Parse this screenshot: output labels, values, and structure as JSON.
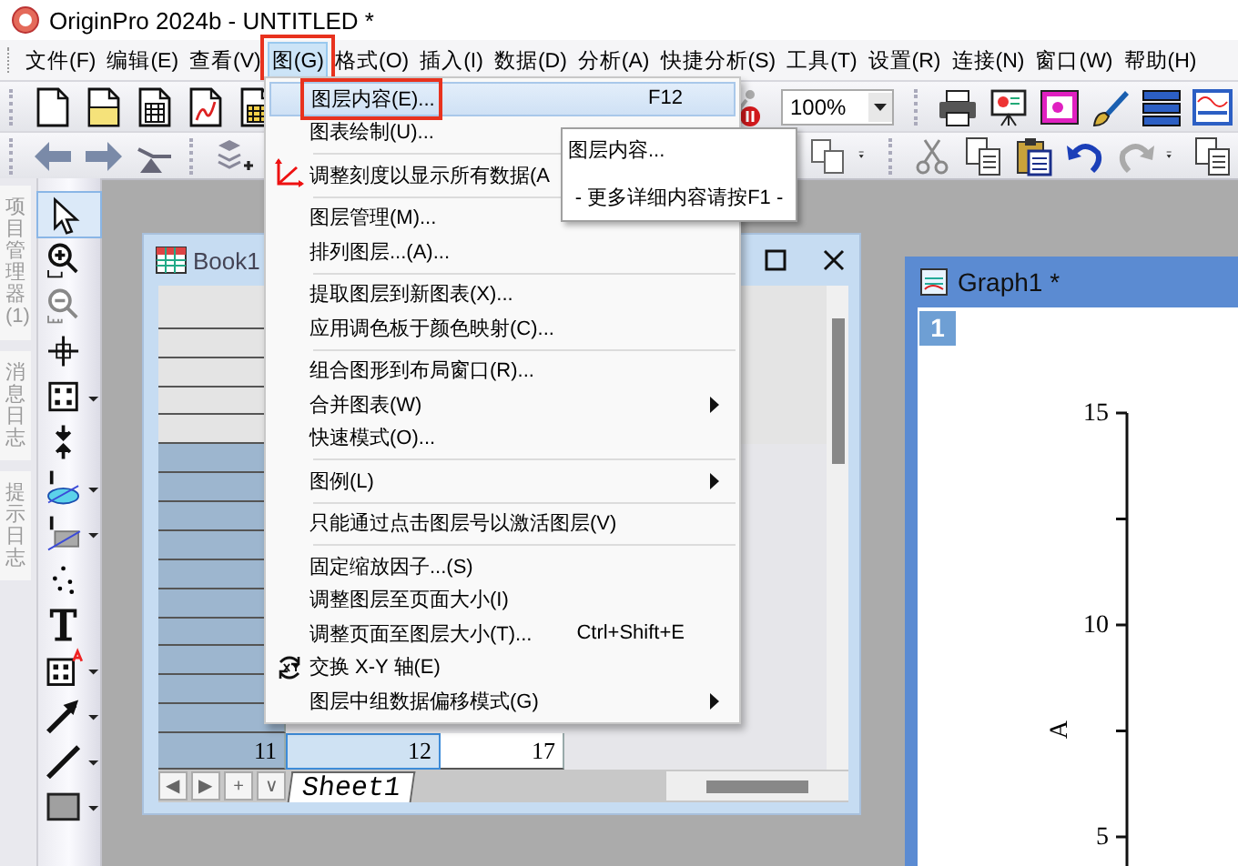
{
  "window": {
    "title": "OriginPro 2024b - UNTITLED *"
  },
  "menu_bar": [
    {
      "label": "文件(F)",
      "selected": false,
      "annotated": false
    },
    {
      "label": "编辑(E)",
      "selected": false,
      "annotated": false
    },
    {
      "label": "查看(V)",
      "selected": false,
      "annotated": false
    },
    {
      "label": "图(G)",
      "selected": true,
      "annotated": true
    },
    {
      "label": "格式(O)",
      "selected": false,
      "annotated": false
    },
    {
      "label": "插入(I)",
      "selected": false,
      "annotated": false
    },
    {
      "label": "数据(D)",
      "selected": false,
      "annotated": false
    },
    {
      "label": "分析(A)",
      "selected": false,
      "annotated": false
    },
    {
      "label": "快捷分析(S)",
      "selected": false,
      "annotated": false
    },
    {
      "label": "工具(T)",
      "selected": false,
      "annotated": false
    },
    {
      "label": "设置(R)",
      "selected": false,
      "annotated": false
    },
    {
      "label": "连接(N)",
      "selected": false,
      "annotated": false
    },
    {
      "label": "窗口(W)",
      "selected": false,
      "annotated": false
    },
    {
      "label": "帮助(H)",
      "selected": false,
      "annotated": false
    }
  ],
  "toolbar": {
    "zoom_combo": {
      "value": "100%"
    }
  },
  "side_panels": [
    {
      "label": "项目管理器 (1)"
    },
    {
      "label": "消息日志"
    },
    {
      "label": "提示日志"
    }
  ],
  "book_window": {
    "title": "Book1",
    "last_row": [
      {
        "text": "11",
        "selected": false
      },
      {
        "text": "12",
        "selected": true
      },
      {
        "text": "17",
        "selected": false
      }
    ],
    "sheet_nav": [
      "◀",
      "▶",
      "+",
      "∨"
    ],
    "sheet_tabs": [
      {
        "label": "Sheet1",
        "selected": true
      }
    ]
  },
  "graph_window": {
    "title": "Graph1 *",
    "layer_badge": "1",
    "y_tick_labels": [
      "15",
      "10",
      "5"
    ],
    "y_axis_title": "A"
  },
  "dropdown_menu": {
    "items": [
      {
        "kind": "item",
        "label": "图层内容(E)...",
        "shortcut": "F12",
        "selected": true,
        "annotated": true,
        "submenu": false
      },
      {
        "kind": "item",
        "label": "图表绘制(U)...",
        "selected": false,
        "annotated": false,
        "submenu": false
      },
      {
        "kind": "separator"
      },
      {
        "kind": "item",
        "label": "调整刻度以显示所有数据(A",
        "selected": false,
        "annotated": false,
        "submenu": false
      },
      {
        "kind": "separator"
      },
      {
        "kind": "item",
        "label": "图层管理(M)...",
        "selected": false,
        "annotated": false,
        "submenu": false
      },
      {
        "kind": "item",
        "label": "排列图层...(A)...",
        "selected": false,
        "annotated": false,
        "submenu": false
      },
      {
        "kind": "separator"
      },
      {
        "kind": "item",
        "label": "提取图层到新图表(X)...",
        "selected": false,
        "annotated": false,
        "submenu": false
      },
      {
        "kind": "item",
        "label": "应用调色板于颜色映射(C)...",
        "selected": false,
        "annotated": false,
        "submenu": false
      },
      {
        "kind": "separator"
      },
      {
        "kind": "item",
        "label": "组合图形到布局窗口(R)...",
        "selected": false,
        "annotated": false,
        "submenu": false
      },
      {
        "kind": "item",
        "label": "合并图表(W)",
        "selected": false,
        "annotated": false,
        "submenu": true
      },
      {
        "kind": "item",
        "label": "快速模式(O)...",
        "selected": false,
        "annotated": false,
        "submenu": false
      },
      {
        "kind": "separator"
      },
      {
        "kind": "item",
        "label": "图例(L)",
        "selected": false,
        "annotated": false,
        "submenu": true
      },
      {
        "kind": "separator"
      },
      {
        "kind": "item",
        "label": "只能通过点击图层号以激活图层(V)",
        "selected": false,
        "annotated": false,
        "submenu": false
      },
      {
        "kind": "separator"
      },
      {
        "kind": "item",
        "label": "固定缩放因子...(S)",
        "selected": false,
        "annotated": false,
        "submenu": false
      },
      {
        "kind": "item",
        "label": "调整图层至页面大小(I)",
        "selected": false,
        "annotated": false,
        "submenu": false
      },
      {
        "kind": "item",
        "label": "调整页面至图层大小(T)...",
        "shortcut": "Ctrl+Shift+E",
        "selected": false,
        "annotated": false,
        "submenu": false
      },
      {
        "kind": "item",
        "label": "交换 X-Y 轴(E)",
        "selected": false,
        "annotated": false,
        "submenu": false
      },
      {
        "kind": "item",
        "label": "图层中组数据偏移模式(G)",
        "selected": false,
        "annotated": false,
        "submenu": true
      }
    ]
  },
  "tooltip": {
    "title": "图层内容...",
    "hint": "- 更多详细内容请按F1 -"
  }
}
